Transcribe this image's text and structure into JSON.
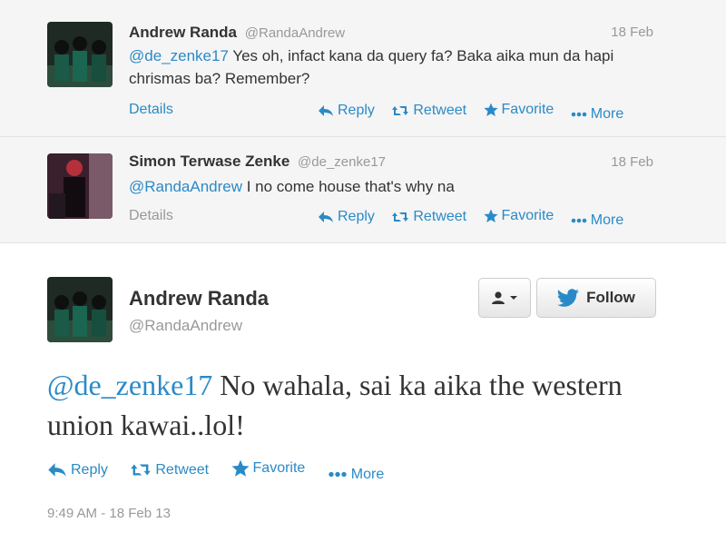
{
  "replies": [
    {
      "name": "Andrew Randa",
      "handle": "@RandaAndrew",
      "date": "18 Feb",
      "mention": "@de_zenke17",
      "text": " Yes oh, infact kana da query fa? Baka aika mun da hapi chrismas ba? Remember?",
      "details": "Details"
    },
    {
      "name": "Simon Terwase Zenke",
      "handle": "@de_zenke17",
      "date": "18 Feb",
      "mention": "@RandaAndrew",
      "text": " I no come house that's why na",
      "details": "Details"
    }
  ],
  "actions": {
    "reply": "Reply",
    "retweet": "Retweet",
    "favorite": "Favorite",
    "more": "More"
  },
  "main": {
    "name": "Andrew Randa",
    "handle": "@RandaAndrew",
    "follow_label": "Follow",
    "mention": "@de_zenke17",
    "text": " No wahala, sai ka aika the western union kawai..lol!",
    "timestamp": "9:49 AM - 18 Feb 13"
  },
  "colors": {
    "link": "#2a8ac7",
    "twitter_bird": "#2a8ac7",
    "muted": "#999999"
  }
}
